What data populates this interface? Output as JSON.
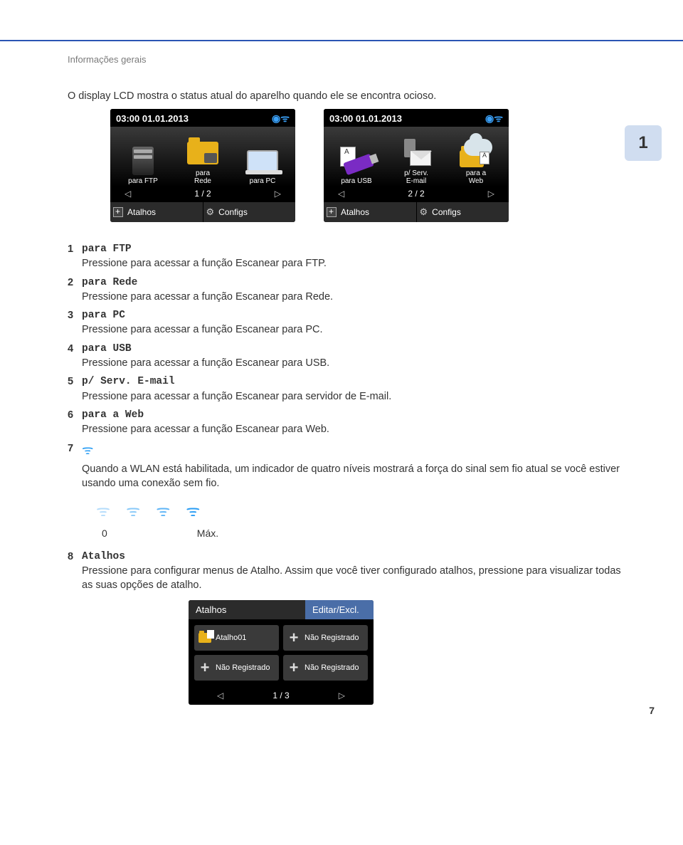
{
  "header": {
    "section": "Informações gerais"
  },
  "intro": "O display LCD mostra o status atual do aparelho quando ele se encontra ocioso.",
  "chapter_tab": "1",
  "screens": {
    "left": {
      "datetime": "03:00  01.01.2013",
      "items": [
        {
          "label1": "para FTP",
          "label2": ""
        },
        {
          "label1": "para",
          "label2": "Rede"
        },
        {
          "label1": "para PC",
          "label2": ""
        }
      ],
      "pager": "1 / 2",
      "bottom": {
        "atalhos": "Atalhos",
        "configs": "Configs"
      }
    },
    "right": {
      "datetime": "03:00  01.01.2013",
      "items": [
        {
          "label1": "para USB",
          "label2": ""
        },
        {
          "label1": "p/ Serv.",
          "label2": "E-mail"
        },
        {
          "label1": "para a",
          "label2": "Web"
        }
      ],
      "pager": "2 / 2",
      "bottom": {
        "atalhos": "Atalhos",
        "configs": "Configs"
      }
    }
  },
  "list": [
    {
      "num": "1",
      "term": "para FTP",
      "desc": "Pressione para acessar a função Escanear para FTP."
    },
    {
      "num": "2",
      "term": "para Rede",
      "desc": "Pressione para acessar a função Escanear para Rede."
    },
    {
      "num": "3",
      "term": "para PC",
      "desc": "Pressione para acessar a função Escanear para PC."
    },
    {
      "num": "4",
      "term": "para USB",
      "desc": "Pressione para acessar a função Escanear para USB."
    },
    {
      "num": "5",
      "term": "p/ Serv. E-mail",
      "desc": "Pressione para acessar a função Escanear para servidor de E-mail."
    },
    {
      "num": "6",
      "term": "para a Web",
      "desc": "Pressione para acessar a função Escanear para Web."
    }
  ],
  "item7": {
    "num": "7",
    "desc": "Quando a WLAN está habilitada, um indicador de quatro níveis mostrará a força do sinal sem fio atual se você estiver usando uma conexão sem fio."
  },
  "wifi_scale": {
    "min": "0",
    "max": "Máx."
  },
  "item8": {
    "num": "8",
    "term": "Atalhos",
    "desc": "Pressione para configurar menus de Atalho. Assim que você tiver configurado atalhos, pressione para visualizar todas as suas opções de atalho."
  },
  "atalhos_screen": {
    "title": "Atalhos",
    "edit": "Editar/Excl.",
    "cells": [
      "Atalho01",
      "Não Registrado",
      "Não Registrado",
      "Não Registrado"
    ],
    "pager": "1 / 3"
  },
  "page_number": "7"
}
